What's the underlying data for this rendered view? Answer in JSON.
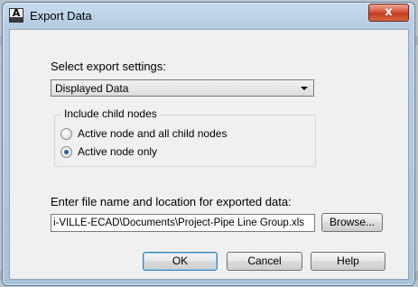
{
  "window": {
    "title": "Export Data",
    "app_icon_letter": "A",
    "close_glyph": "x"
  },
  "export_settings": {
    "label": "Select export settings:",
    "selected": "Displayed Data"
  },
  "child_nodes": {
    "group_label": "Include child nodes",
    "options": [
      {
        "label": "Active node and all child nodes",
        "checked": false
      },
      {
        "label": "Active node only",
        "checked": true
      }
    ]
  },
  "file": {
    "label": "Enter file name and location for exported data:",
    "value": "i-VILLE-ECAD\\Documents\\Project-Pipe Line Group.xls",
    "browse_label": "Browse..."
  },
  "buttons": {
    "ok": "OK",
    "cancel": "Cancel",
    "help": "Help"
  }
}
